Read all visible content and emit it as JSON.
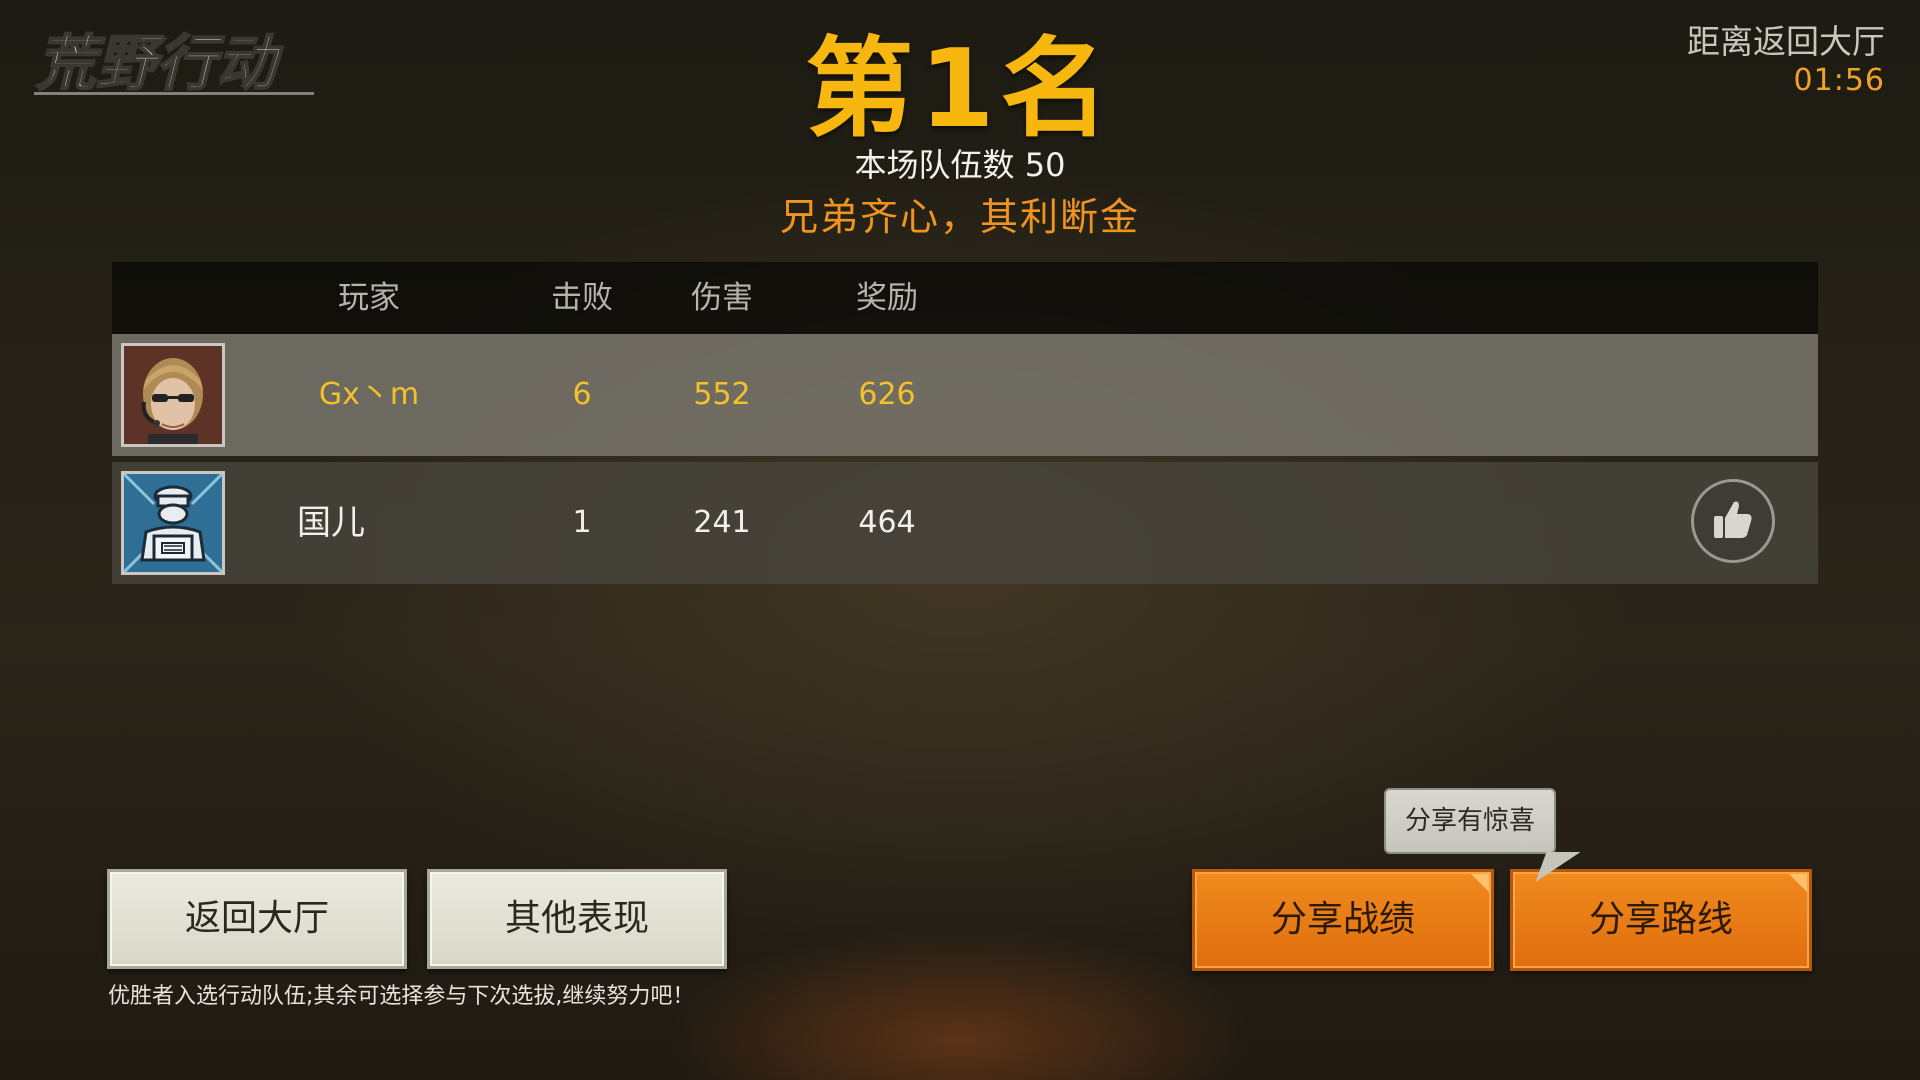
{
  "header": {
    "logo_text": "荒野行动",
    "rank_title": "第1名",
    "team_count_label": "本场队伍数 50",
    "slogan": "兄弟齐心，其利断金"
  },
  "timer": {
    "label": "距离返回大厅",
    "value": "01:56"
  },
  "table": {
    "columns": [
      "玩家",
      "击败",
      "伤害",
      "奖励"
    ],
    "rows": [
      {
        "player": "Gx丶m",
        "kills": "6",
        "damage": "552",
        "reward": "626",
        "highlight": true,
        "avatar": "player-portrait"
      },
      {
        "player": "国儿",
        "kills": "1",
        "damage": "241",
        "reward": "464",
        "highlight": false,
        "avatar": "chef-avatar-icon"
      }
    ]
  },
  "buttons": {
    "back_lobby": "返回大厅",
    "other_performance": "其他表现",
    "share_record": "分享战绩",
    "share_route": "分享路线"
  },
  "tooltip": {
    "text": "分享有惊喜"
  },
  "hint_text": "优胜者入选行动队伍;其余可选择参与下次选拔,继续努力吧！",
  "colors": {
    "rank_gold": "#f7b70f",
    "slogan_orange": "#f0941f",
    "timer_orange": "#f2a127",
    "highlight_text": "#f4c12a",
    "button_orange": "#e97c16"
  }
}
